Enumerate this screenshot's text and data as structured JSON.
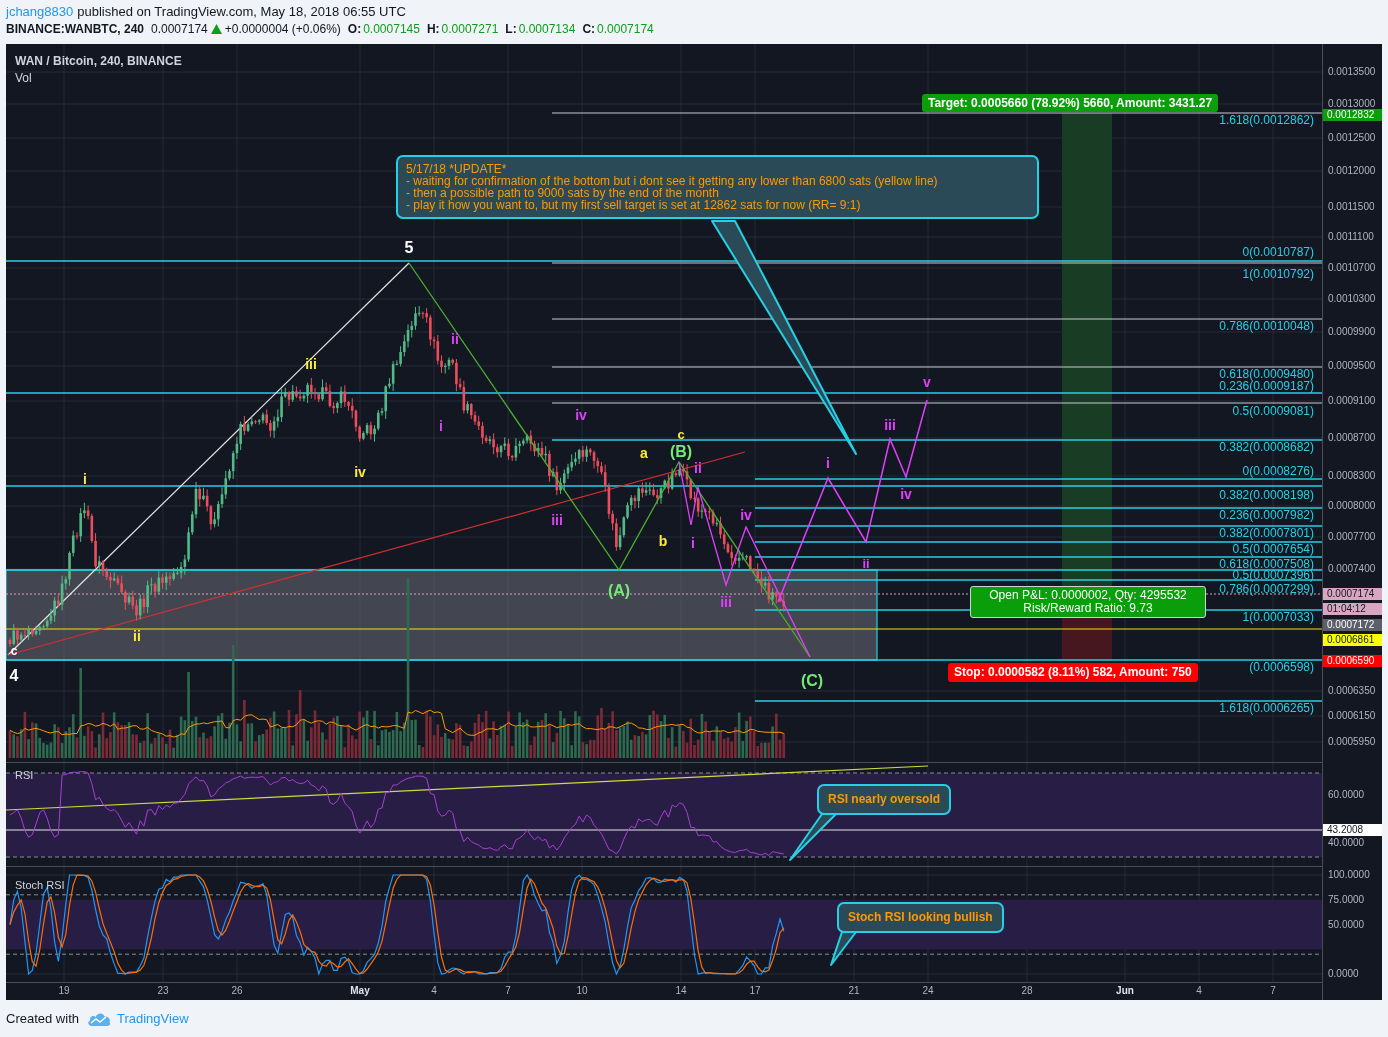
{
  "header": {
    "author": "jchang8830",
    "published": "published on TradingView.com, May 18, 2018 06:55 UTC"
  },
  "symbol_bar": {
    "symbol": "BINANCE:WANBTC, 240",
    "last": "0.0007174",
    "rising": true,
    "change": "+0.0000004 (+0.06%)",
    "ohlc": [
      {
        "label": "O:",
        "value": "0.0007145"
      },
      {
        "label": "H:",
        "value": "0.0007271"
      },
      {
        "label": "L:",
        "value": "0.0007134"
      },
      {
        "label": "C:",
        "value": "0.0007174"
      }
    ]
  },
  "chart": {
    "title": "WAN / Bitcoin, 240, BINANCE",
    "volume_label": "Vol",
    "price_axis": [
      "0.0013500",
      "0.0013000",
      "0.0012500",
      "0.0012000",
      "0.0011500",
      "0.0011100",
      "0.0010700",
      "0.0010300",
      "0.0009900",
      "0.0009500",
      "0.0009100",
      "0.0008700",
      "0.0008300",
      "0.0008000",
      "0.0007700",
      "0.0007400",
      "0.0006350",
      "0.0006150",
      "0.0005950"
    ],
    "price_tags": [
      {
        "text": "0.0012832",
        "color": "#0a9e0a"
      },
      {
        "text": "0.0007174",
        "color": "#d8a6c0"
      },
      {
        "text": "01:04:12",
        "color": "#d8a6c0"
      },
      {
        "text": "0.0007172",
        "color": "#5d606b"
      },
      {
        "text": "0.0006861",
        "color": "#ffff00"
      },
      {
        "text": "0.0006590",
        "color": "#ff0000"
      }
    ],
    "fib_levels": [
      "1.618(0.0012862)",
      "0(0.0010787)",
      "1(0.0010792)",
      "0.786(0.0010048)",
      "0.618(0.0009480)",
      "0.236(0.0009187)",
      "0.5(0.0009081)",
      "0.382(0.0008682)",
      "0(0.0008276)",
      "0.382(0.0008198)",
      "0.236(0.0007982)",
      "0.382(0.0007801)",
      "0.5(0.0007654)",
      "0.618(0.0007508)",
      "0.5(0.0007396)",
      "0.786(0.0007299)",
      "1(0.0007033)",
      "(0.0006598)",
      "1.618(0.0006265)"
    ],
    "wave_labels": [
      {
        "text": "c",
        "color": "#ffffff"
      },
      {
        "text": "4",
        "color": "#ffffff"
      },
      {
        "text": "i",
        "color": "#ffeb3b"
      },
      {
        "text": "ii",
        "color": "#ffeb3b"
      },
      {
        "text": "iii",
        "color": "#ffeb3b"
      },
      {
        "text": "iv",
        "color": "#ffeb3b"
      },
      {
        "text": "5",
        "color": "#ffffff"
      },
      {
        "text": "ii",
        "color": "#e040fb"
      },
      {
        "text": "i",
        "color": "#e040fb"
      },
      {
        "text": "iv",
        "color": "#e040fb"
      },
      {
        "text": "iii",
        "color": "#e040fb"
      },
      {
        "text": "a",
        "color": "#ffeb3b"
      },
      {
        "text": "c",
        "color": "#ffeb3b"
      },
      {
        "text": "(B)",
        "color": "#76e876"
      },
      {
        "text": "b",
        "color": "#ffeb3b"
      },
      {
        "text": "(A)",
        "color": "#76e876"
      },
      {
        "text": "ii",
        "color": "#e040fb"
      },
      {
        "text": "i",
        "color": "#e040fb"
      },
      {
        "text": "iv",
        "color": "#e040fb"
      },
      {
        "text": "iii",
        "color": "#e040fb"
      },
      {
        "text": "(C)",
        "color": "#76e876"
      },
      {
        "text": "i",
        "color": "#e040fb"
      },
      {
        "text": "ii",
        "color": "#e040fb"
      },
      {
        "text": "iii",
        "color": "#e040fb"
      },
      {
        "text": "iv",
        "color": "#e040fb"
      },
      {
        "text": "v",
        "color": "#e040fb"
      }
    ],
    "update_note": [
      "5/17/18 *UPDATE*",
      "- waiting for confirmation of the bottom but i dont see it getting any lower than 6800 sats (yellow line)",
      "- then a possible path to 9000 sats by the end of the month",
      "- play it how you want to, but my first sell target is set at 12862 sats for now (RR= 9:1)"
    ],
    "target": "Target: 0.0005660 (78.92%) 5660, Amount: 3431.27",
    "position": [
      "Open P&L: 0.0000002, Qty: 4295532",
      "Risk/Reward Ratio: 9.73"
    ],
    "stop": "Stop: 0.0000582 (8.11%) 582, Amount: 750"
  },
  "rsi": {
    "title": "RSI",
    "axis": [
      "60.0000",
      "40.0000"
    ],
    "value_tag": "43.2008",
    "note": "RSI nearly oversold"
  },
  "stoch_rsi": {
    "title": "Stoch RSI",
    "axis": [
      "100.0000",
      "75.0000",
      "50.0000",
      "0.0000"
    ],
    "note": "Stoch RSI looking bullish"
  },
  "time_axis": [
    {
      "text": "19",
      "kind": "day"
    },
    {
      "text": "23",
      "kind": "day"
    },
    {
      "text": "26",
      "kind": "day"
    },
    {
      "text": "May",
      "kind": "month"
    },
    {
      "text": "4",
      "kind": "day"
    },
    {
      "text": "7",
      "kind": "day"
    },
    {
      "text": "10",
      "kind": "day"
    },
    {
      "text": "14",
      "kind": "day"
    },
    {
      "text": "17",
      "kind": "day"
    },
    {
      "text": "21",
      "kind": "day"
    },
    {
      "text": "24",
      "kind": "day"
    },
    {
      "text": "28",
      "kind": "day"
    },
    {
      "text": "Jun",
      "kind": "month"
    },
    {
      "text": "4",
      "kind": "day"
    },
    {
      "text": "7",
      "kind": "day"
    }
  ],
  "footer": {
    "created_with": "Created with",
    "brand": "TradingView"
  }
}
